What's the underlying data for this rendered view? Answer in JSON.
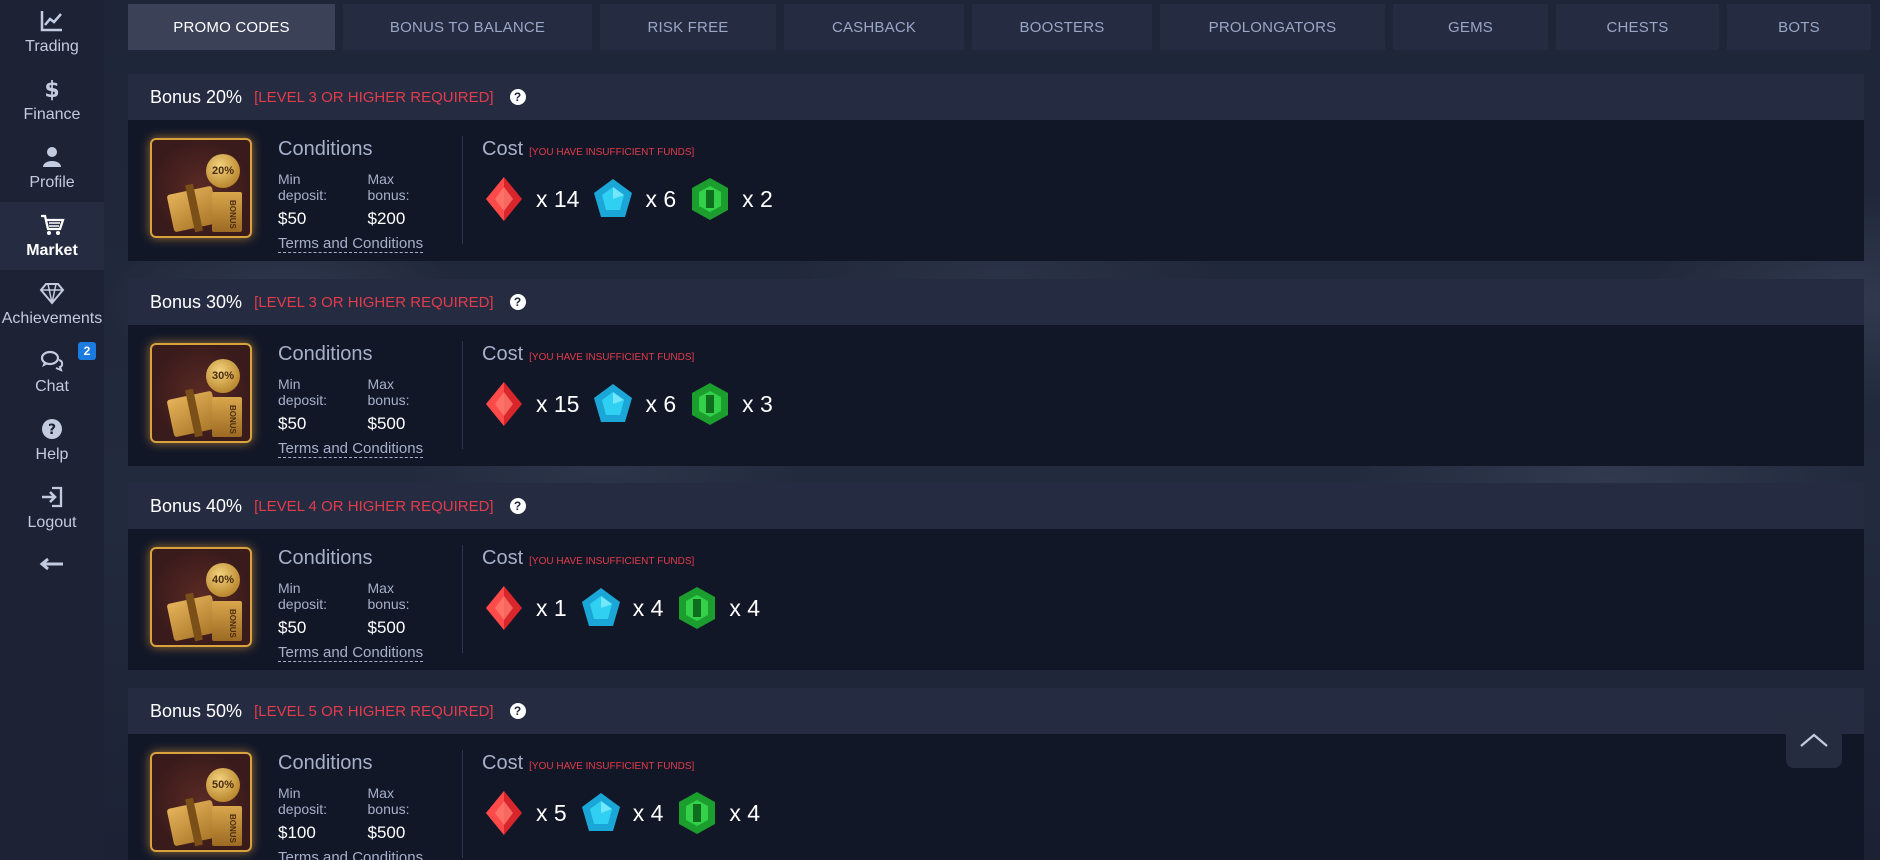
{
  "sidebar": {
    "items": [
      {
        "label": "Trading",
        "icon": "chart-line-icon"
      },
      {
        "label": "Finance",
        "icon": "dollar-icon"
      },
      {
        "label": "Profile",
        "icon": "user-icon"
      },
      {
        "label": "Market",
        "icon": "cart-icon",
        "active": true
      },
      {
        "label": "Achievements",
        "icon": "diamond-icon"
      },
      {
        "label": "Chat",
        "icon": "chat-icon",
        "badge": "2"
      },
      {
        "label": "Help",
        "icon": "help-icon"
      },
      {
        "label": "Logout",
        "icon": "logout-icon"
      }
    ]
  },
  "tabs": [
    {
      "label": "PROMO CODES",
      "active": true
    },
    {
      "label": "BONUS TO BALANCE"
    },
    {
      "label": "RISK FREE"
    },
    {
      "label": "CASHBACK"
    },
    {
      "label": "BOOSTERS"
    },
    {
      "label": "PROLONGATORS"
    },
    {
      "label": "GEMS"
    },
    {
      "label": "CHESTS"
    },
    {
      "label": "BOTS"
    }
  ],
  "common": {
    "conditions": "Conditions",
    "min_deposit_label": "Min deposit:",
    "max_bonus_label": "Max bonus:",
    "terms": "Terms and Conditions",
    "cost": "Cost",
    "insufficient": "[YOU HAVE INSUFFICIENT FUNDS]",
    "box_text": "BONUS"
  },
  "bonuses": [
    {
      "title": "Bonus 20%",
      "req": "[LEVEL 3 OR HIGHER REQUIRED]",
      "badge": "20%",
      "min_deposit": "$50",
      "max_bonus": "$200",
      "gems": {
        "red": "x 14",
        "blue": "x 6",
        "green": "x 2"
      }
    },
    {
      "title": "Bonus 30%",
      "req": "[LEVEL 3 OR HIGHER REQUIRED]",
      "badge": "30%",
      "min_deposit": "$50",
      "max_bonus": "$500",
      "gems": {
        "red": "x 15",
        "blue": "x 6",
        "green": "x 3"
      }
    },
    {
      "title": "Bonus 40%",
      "req": "[LEVEL 4 OR HIGHER REQUIRED]",
      "badge": "40%",
      "min_deposit": "$50",
      "max_bonus": "$500",
      "gems": {
        "red": "x 1",
        "blue": "x 4",
        "green": "x 4"
      }
    },
    {
      "title": "Bonus 50%",
      "req": "[LEVEL 5 OR HIGHER REQUIRED]",
      "badge": "50%",
      "min_deposit": "$100",
      "max_bonus": "$500",
      "gems": {
        "red": "x 5",
        "blue": "x 4",
        "green": "x 4"
      }
    }
  ],
  "colors": {
    "accent_red": "#e23b4a",
    "badge_blue": "#1b7be0",
    "gold": "#d8a33c"
  }
}
